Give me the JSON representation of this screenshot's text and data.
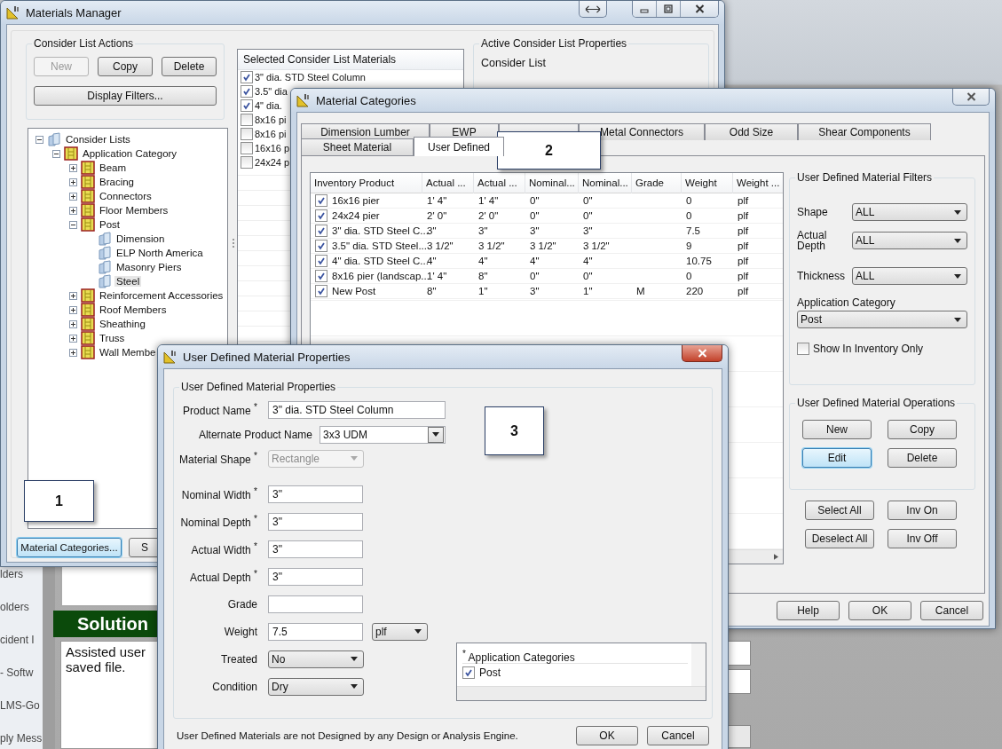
{
  "background_app": {
    "sidebar_items": [
      "lders",
      "olders",
      "cident I",
      "- Softw",
      "LMS-Go",
      "ply Mess"
    ],
    "banner": "Solution",
    "notes_lines": [
      "Assisted user",
      "saved file."
    ]
  },
  "materials_manager": {
    "title": "Materials Manager",
    "actions": {
      "title": "Consider List Actions",
      "buttons": [
        {
          "label": "New",
          "disabled": true
        },
        {
          "label": "Copy",
          "disabled": false
        },
        {
          "label": "Delete",
          "disabled": false
        }
      ],
      "display_filters": "Display Filters..."
    },
    "tree": [
      {
        "label": "Consider Lists",
        "kind": "list",
        "expanded": true,
        "selected": false,
        "children": [
          {
            "label": "Application Category",
            "kind": "category",
            "expanded": true,
            "selected": false,
            "children": [
              {
                "label": "Beam",
                "kind": "category",
                "expanded": false,
                "selected": false
              },
              {
                "label": "Bracing",
                "kind": "category",
                "expanded": false,
                "selected": false
              },
              {
                "label": "Connectors",
                "kind": "category",
                "expanded": false,
                "selected": false
              },
              {
                "label": "Floor Members",
                "kind": "category",
                "expanded": false,
                "selected": false
              },
              {
                "label": "Post",
                "kind": "category",
                "expanded": true,
                "selected": false,
                "children": [
                  {
                    "label": "Dimension",
                    "kind": "list",
                    "selected": false
                  },
                  {
                    "label": "ELP North America",
                    "kind": "list",
                    "selected": false
                  },
                  {
                    "label": "Masonry Piers",
                    "kind": "list",
                    "selected": false
                  },
                  {
                    "label": "Steel",
                    "kind": "list",
                    "selected": true
                  }
                ]
              },
              {
                "label": "Reinforcement Accessories",
                "kind": "category",
                "expanded": false,
                "selected": false
              },
              {
                "label": "Roof Members",
                "kind": "category",
                "expanded": false,
                "selected": false
              },
              {
                "label": "Sheathing",
                "kind": "category",
                "expanded": false,
                "selected": false
              },
              {
                "label": "Truss",
                "kind": "category",
                "expanded": false,
                "selected": false
              },
              {
                "label": "Wall Membe",
                "kind": "category",
                "expanded": false,
                "selected": false
              }
            ]
          }
        ]
      }
    ],
    "selected_materials": {
      "title": "Selected Consider List Materials",
      "items": [
        {
          "label": "3\" dia. STD Steel Column",
          "checked": true
        },
        {
          "label": "3.5\" dia",
          "checked": true
        },
        {
          "label": "4\" dia.",
          "checked": true
        },
        {
          "label": "8x16 pi",
          "checked": false
        },
        {
          "label": "8x16 pi",
          "checked": false
        },
        {
          "label": "16x16 p",
          "checked": false
        },
        {
          "label": "24x24 p",
          "checked": false
        }
      ]
    },
    "active_properties": {
      "title": "Active Consider List Properties",
      "label": "Consider List"
    },
    "bottom_buttons": [
      {
        "label": "Material Categories...",
        "focused": true
      },
      {
        "label": "S",
        "focused": false
      }
    ]
  },
  "material_categories": {
    "title": "Material Categories",
    "tab_rows": [
      [
        {
          "label": "Dimension Lumber",
          "selected": false
        },
        {
          "label": "EWP",
          "selected": false
        },
        {
          "selected": false
        },
        {
          "label": "Metal Connectors",
          "selected": false
        },
        {
          "label": "Odd Size",
          "selected": false
        },
        {
          "label": "Shear Components",
          "selected": false
        }
      ],
      [
        {
          "label": "Sheet Material",
          "selected": false
        },
        {
          "label": "User Defined",
          "selected": true
        }
      ]
    ],
    "table": {
      "columns": [
        "Inventory Product",
        "Actual ...",
        "Actual ...",
        "Nominal...",
        "Nominal...",
        "Grade",
        "Weight",
        "Weight ..."
      ],
      "rows": [
        {
          "checked": true,
          "cells": [
            "16x16 pier",
            "1' 4\"",
            "1' 4\"",
            "0\"",
            "0\"",
            "",
            "0",
            "plf"
          ]
        },
        {
          "checked": true,
          "cells": [
            "24x24 pier",
            "2' 0\"",
            "2' 0\"",
            "0\"",
            "0\"",
            "",
            "0",
            "plf"
          ]
        },
        {
          "checked": true,
          "cells": [
            "3\" dia. STD Steel C...",
            "3\"",
            "3\"",
            "3\"",
            "3\"",
            "",
            "7.5",
            "plf"
          ]
        },
        {
          "checked": true,
          "cells": [
            "3.5\" dia. STD Steel...",
            "3 1/2\"",
            "3 1/2\"",
            "3 1/2\"",
            "3 1/2\"",
            "",
            "9",
            "plf"
          ]
        },
        {
          "checked": true,
          "cells": [
            "4\" dia. STD Steel C...",
            "4\"",
            "4\"",
            "4\"",
            "4\"",
            "",
            "10.75",
            "plf"
          ]
        },
        {
          "checked": true,
          "cells": [
            "8x16 pier (landscap...",
            "1' 4\"",
            "8\"",
            "0\"",
            "0\"",
            "",
            "0",
            "plf"
          ]
        },
        {
          "checked": true,
          "cells": [
            "New Post",
            "8\"",
            "1\"",
            "3\"",
            "1\"",
            "M",
            "220",
            "plf"
          ]
        }
      ]
    },
    "filters": {
      "title": "User Defined Material Filters",
      "fields": [
        {
          "label": "Shape",
          "value": "ALL"
        },
        {
          "label": "Actual Depth",
          "value": "ALL"
        },
        {
          "label": "Thickness",
          "value": "ALL"
        }
      ],
      "application_category": {
        "label": "Application Category",
        "value": "Post"
      },
      "show_in_inventory": {
        "label": "Show In Inventory Only",
        "checked": false
      }
    },
    "operations": {
      "title": "User Defined Material Operations",
      "buttons": [
        {
          "label": "New",
          "focused": false
        },
        {
          "label": "Copy",
          "focused": false
        },
        {
          "label": "Edit",
          "focused": true
        },
        {
          "label": "Delete",
          "focused": false
        }
      ]
    },
    "selection_buttons": [
      "Select All",
      "Inv On",
      "Deselect All",
      "Inv Off"
    ],
    "footer_buttons": [
      "Help",
      "OK",
      "Cancel"
    ]
  },
  "udm_properties": {
    "title": "User Defined Material Properties",
    "group_title": "User Defined Material Properties",
    "fields": [
      {
        "label": "Product Name $^{*}$",
        "kind": "text",
        "value": "3\" dia. STD Steel Column",
        "disabled": false
      },
      {
        "label": "Alternate Product Name",
        "kind": "combo",
        "value": "3x3 UDM",
        "disabled": false
      },
      {
        "label": "Material Shape $^{*}$",
        "kind": "select",
        "value": "Rectangle",
        "disabled": true
      },
      {
        "label": "Nominal Width $^{*}$",
        "kind": "text",
        "value": "3\"",
        "disabled": false
      },
      {
        "label": "Nominal Depth $^{*}$",
        "kind": "text",
        "value": "3\"",
        "disabled": false
      },
      {
        "label": "Actual Width $^{*}$",
        "kind": "text",
        "value": "3\"",
        "disabled": false
      },
      {
        "label": "Actual Depth $^{*}$",
        "kind": "text",
        "value": "3\"",
        "disabled": false
      },
      {
        "label": "Grade",
        "kind": "text",
        "disabled": false
      },
      {
        "label": "Weight",
        "kind": "text",
        "value": "7.5",
        "unit": "plf",
        "disabled": false
      },
      {
        "label": "Treated",
        "kind": "select",
        "value": "No",
        "disabled": false
      },
      {
        "label": "Condition",
        "kind": "select",
        "value": "Dry",
        "disabled": false
      }
    ],
    "application_categories": {
      "header": "$^{*}$ Application Categories",
      "items": [
        {
          "label": "Post",
          "checked": true
        }
      ]
    },
    "note": "User Defined Materials are not Designed by any Design or Analysis Engine.",
    "buttons": [
      "OK",
      "Cancel"
    ]
  },
  "callouts": [
    "1",
    "2",
    "3"
  ]
}
